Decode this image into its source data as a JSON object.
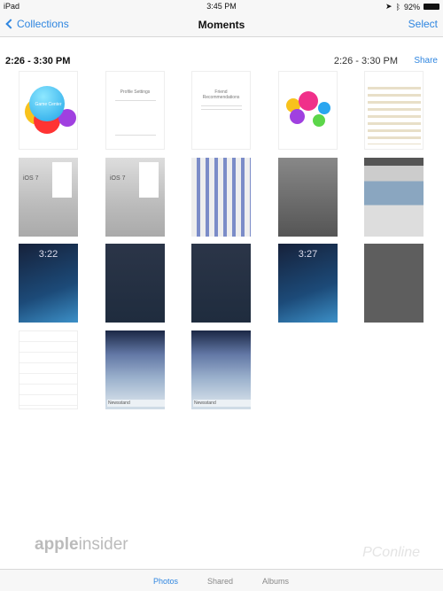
{
  "status": {
    "device": "iPad",
    "time": "3:45 PM",
    "battery": "92%"
  },
  "nav": {
    "back": "Collections",
    "title": "Moments",
    "select": "Select"
  },
  "section": {
    "title": "2:26 - 3:30 PM",
    "range": "2:26 - 3:30 PM",
    "share": "Share"
  },
  "thumbs": {
    "game_center": "Game Center",
    "profile": "Profile Settings",
    "friends": "Friend Recommendations",
    "ios7": "iOS 7",
    "lock1": "3:22",
    "lock2": "3:27",
    "newsstand": "Newsstand"
  },
  "watermark": {
    "logo": "appleinsider",
    "pconline": "PConline"
  },
  "tabs": [
    {
      "label": "Photos",
      "active": true
    },
    {
      "label": "Shared"
    },
    {
      "label": "Albums"
    }
  ],
  "colors": {
    "accent": "#2f86e0"
  }
}
